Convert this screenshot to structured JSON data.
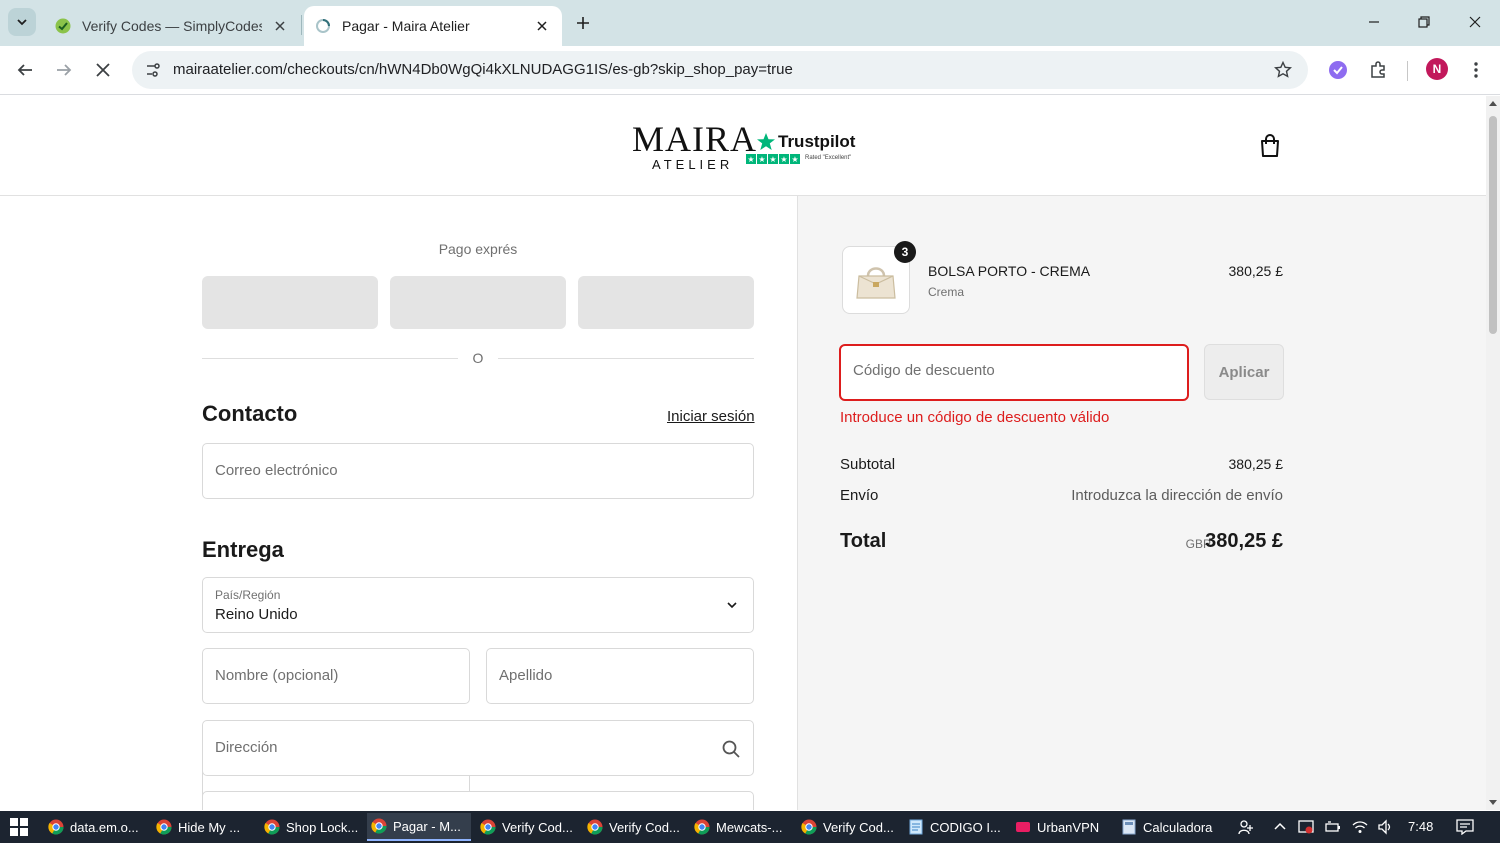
{
  "browser": {
    "tabs": [
      {
        "title": "Verify Codes — SimplyCodes",
        "active": false,
        "favicon": "simplycodes-icon"
      },
      {
        "title": "Pagar - Maira Atelier",
        "active": true,
        "favicon": "loading-icon"
      }
    ],
    "url": "mairaatelier.com/checkouts/cn/hWN4Db0WgQi4kXLNUDAGG1IS/es-gb?skip_shop_pay=true",
    "profile_initial": "N"
  },
  "header": {
    "logo_main": "MAIRA",
    "logo_sub": "ATELIER",
    "trustpilot_label": "Trustpilot",
    "trustpilot_rated": "Rated \"Excellent\""
  },
  "checkout": {
    "express_label": "Pago exprés",
    "or_text": "O",
    "contact_heading": "Contacto",
    "signin_link": "Iniciar sesión",
    "email_placeholder": "Correo electrónico",
    "delivery_heading": "Entrega",
    "country_label": "País/Región",
    "country_value": "Reino Unido",
    "first_name_placeholder": "Nombre (opcional)",
    "last_name_placeholder": "Apellido",
    "address_placeholder": "Dirección"
  },
  "summary": {
    "item": {
      "name": "BOLSA PORTO - CREMA",
      "variant": "Crema",
      "price": "380,25 £",
      "quantity": "3"
    },
    "discount_placeholder": "Código de descuento",
    "apply_label": "Aplicar",
    "error_message": "Introduce un código de descuento válido",
    "subtotal_label": "Subtotal",
    "subtotal_value": "380,25 £",
    "shipping_label": "Envío",
    "shipping_value": "Introduzca la dirección de envío",
    "total_label": "Total",
    "total_currency": "GBP",
    "total_value": "380,25 £"
  },
  "taskbar": {
    "apps": [
      {
        "label": "data.em.o...",
        "icon": "chrome-icon",
        "active": false
      },
      {
        "label": "Hide My ...",
        "icon": "chrome-icon",
        "active": false
      },
      {
        "label": "Shop Lock...",
        "icon": "chrome-icon",
        "active": false
      },
      {
        "label": "Pagar - M...",
        "icon": "chrome-icon",
        "active": true
      },
      {
        "label": "Verify Cod...",
        "icon": "chrome-icon",
        "active": false
      },
      {
        "label": "Verify Cod...",
        "icon": "chrome-icon",
        "active": false
      },
      {
        "label": "Mewcats-...",
        "icon": "chrome-icon",
        "active": false
      },
      {
        "label": "Verify Cod...",
        "icon": "chrome-icon",
        "active": false
      },
      {
        "label": "CODIGO I...",
        "icon": "notepad-icon",
        "active": false
      },
      {
        "label": "UrbanVPN",
        "icon": "urbanvpn-icon",
        "active": false
      },
      {
        "label": "Calculadora",
        "icon": "calculator-icon",
        "active": false
      }
    ],
    "clock": "7:48"
  },
  "colors": {
    "error": "#dd1d1d",
    "trustpilot": "#00b67a",
    "tabstrip": "#d3e3e6",
    "taskbar": "#1c2430"
  }
}
